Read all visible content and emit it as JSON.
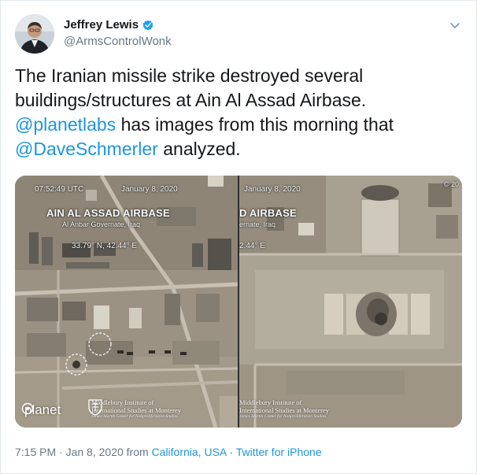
{
  "author": {
    "display_name": "Jeffrey Lewis",
    "handle": "@ArmsControlWonk",
    "verified": true
  },
  "icons": {
    "verified": "verified-badge-icon",
    "more": "chevron-down-icon"
  },
  "tweet": {
    "line1": "The Iranian missile strike destroyed several",
    "line2": "buildings/structures at Ain Al Assad Airbase.",
    "mention1": "@planetlabs",
    "text3": " has images from this morning that",
    "mention2": "@DaveSchmerler",
    "text4": " analyzed."
  },
  "media": {
    "left": {
      "time": "07:52:49 UTC",
      "date": "January 8, 2020",
      "title": "AIN AL ASSAD AIRBASE",
      "subtitle": "Al Anbar Governate, Iraq",
      "coords": "33.79° N, 42.44° E",
      "logo_text": "planet",
      "institute_line1": "Middlebury Institute of",
      "institute_line2": "International Studies at Monterey",
      "institute_line3": "James Martin Center for Nonproliferation Studies"
    },
    "right": {
      "date": "January 8, 2020",
      "title": "D AIRBASE",
      "subtitle": "ernate, Iraq",
      "coords": "2.44° E",
      "copyright": "© 20",
      "institute_line1": "Middlebury Institute of",
      "institute_line2": "International Studies at Monterey",
      "institute_line3": "James Martin Center for Nonproliferation Studies"
    }
  },
  "meta": {
    "time": "7:15 PM",
    "date": "Jan 8, 2020",
    "from_label": "from",
    "location": "California, USA",
    "separator": "·",
    "source": "Twitter for iPhone"
  },
  "colors": {
    "link": "#1b95e0",
    "text": "#14171a",
    "muted": "#657786",
    "verified": "#1da1f2"
  }
}
